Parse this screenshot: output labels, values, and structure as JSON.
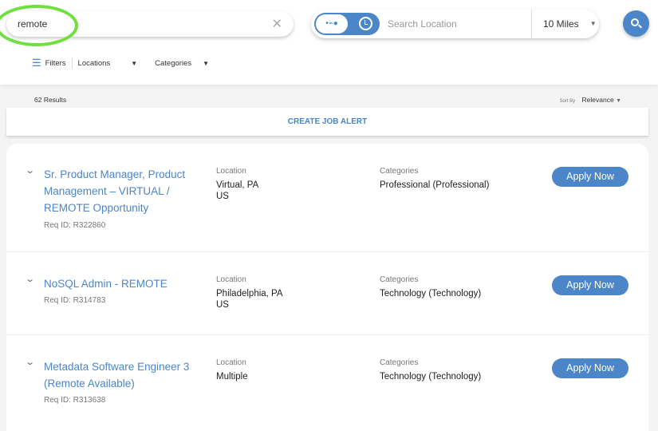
{
  "search": {
    "keyword": "remote",
    "location_placeholder": "Search Location",
    "radius": "10 Miles"
  },
  "filters": {
    "label": "Filters",
    "locations": "Locations",
    "categories": "Categories"
  },
  "results": {
    "count": "62 Results",
    "sort_label": "Sort By",
    "sort_value": "Relevance"
  },
  "alert_label": "CREATE JOB ALERT",
  "labels": {
    "location": "Location",
    "categories": "Categories",
    "apply": "Apply Now"
  },
  "jobs": [
    {
      "title": "Sr. Product Manager, Product Management – VIRTUAL / REMOTE Opportunity",
      "req": "Req ID: R322860",
      "location1": "Virtual, PA",
      "location2": "US",
      "category": "Professional (Professional)"
    },
    {
      "title": "NoSQL Admin - REMOTE",
      "req": "Req ID: R314783",
      "location1": "Philadelphia, PA",
      "location2": "US",
      "category": "Technology (Technology)"
    },
    {
      "title": "Metadata Software Engineer 3 (Remote Available)",
      "req": "Req ID: R313638",
      "location1": "Multiple",
      "location2": "",
      "category": "Technology (Technology)"
    }
  ]
}
